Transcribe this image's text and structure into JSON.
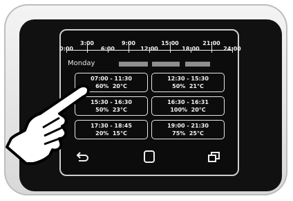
{
  "timeline": {
    "labels": [
      "0:00",
      "3:00",
      "6:00",
      "9:00",
      "12:00",
      "15:00",
      "18:00",
      "21:00",
      "24:00"
    ]
  },
  "day_label": "Monday",
  "slots": [
    {
      "time": "07:00 - 11:30",
      "power": "60%",
      "temp": "20°C"
    },
    {
      "time": "12:30 - 15:30",
      "power": "50%",
      "temp": "21°C"
    },
    {
      "time": "15:30 - 16:30",
      "power": "50%",
      "temp": "23°C"
    },
    {
      "time": "16:30 - 16:31",
      "power": "100%",
      "temp": "20°C"
    },
    {
      "time": "17:30 - 18:45",
      "power": "20%",
      "temp": "15°C"
    },
    {
      "time": "19:00 - 21:30",
      "power": "75%",
      "temp": "25°C"
    }
  ],
  "nav": {
    "back_icon": "back-arrow-icon",
    "home_icon": "square-home-icon",
    "recent_icon": "recent-apps-icon"
  }
}
